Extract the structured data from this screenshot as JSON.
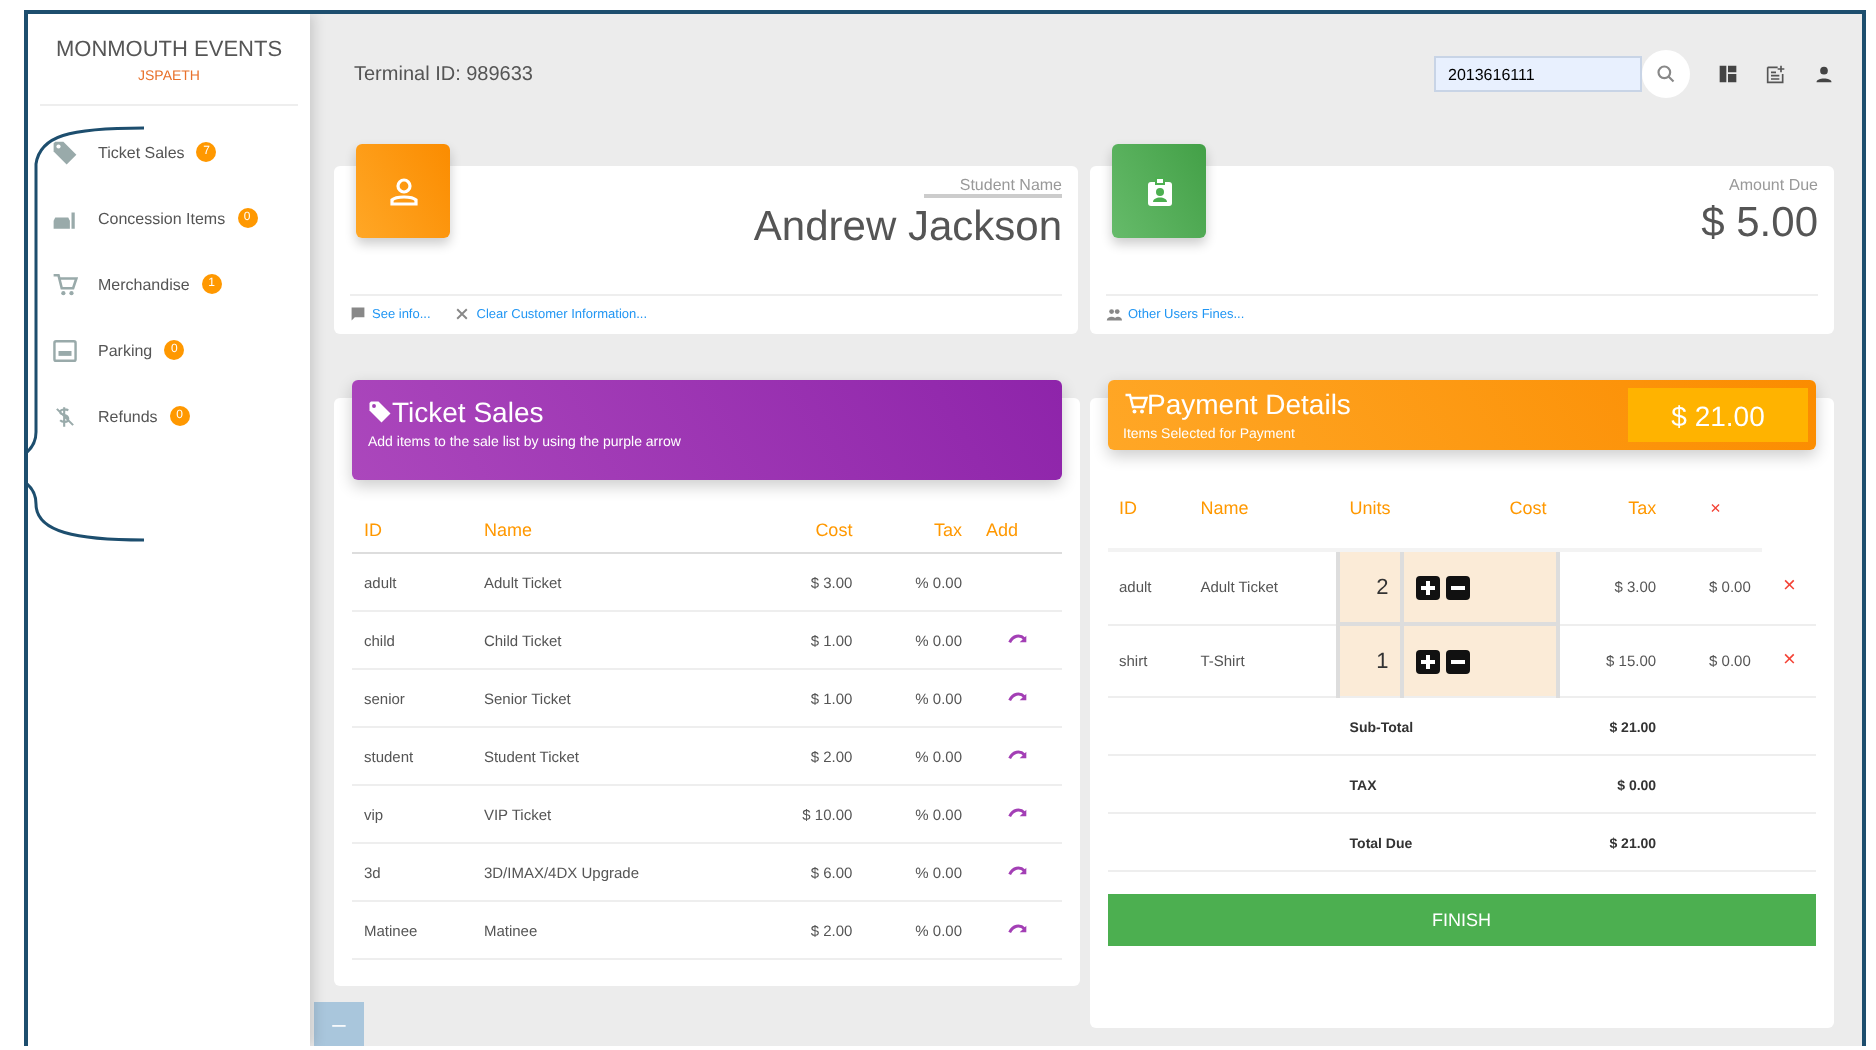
{
  "sidebar": {
    "title": "MONMOUTH EVENTS",
    "user": "JSPAETH",
    "items": [
      {
        "kind": "tag",
        "label": "Ticket Sales",
        "count": "7"
      },
      {
        "kind": "food",
        "label": "Concession Items",
        "count": "0"
      },
      {
        "kind": "cart",
        "label": "Merchandise",
        "count": "1"
      },
      {
        "kind": "parking",
        "label": "Parking",
        "count": "0"
      },
      {
        "kind": "refund",
        "label": "Refunds",
        "count": "0"
      }
    ]
  },
  "topbar": {
    "terminal": "Terminal ID: 989633",
    "search_value": "2013616111"
  },
  "student_card": {
    "label": "Student Name",
    "name": "Andrew Jackson",
    "links": [
      {
        "kind": "info",
        "label": "See info..."
      },
      {
        "kind": "clear",
        "label": "Clear Customer Information..."
      }
    ]
  },
  "amount_card": {
    "label": "Amount Due",
    "amount": "$ 5.00",
    "links": [
      {
        "kind": "users",
        "label": "Other Users Fines..."
      }
    ]
  },
  "ticket_sales": {
    "title": "Ticket Sales",
    "subtitle": "Add items to the sale list by using the purple arrow",
    "columns": [
      "ID",
      "Name",
      "Cost",
      "Tax",
      "Add"
    ],
    "rows": [
      {
        "id": "adult",
        "name": "Adult Ticket",
        "cost": "$ 3.00",
        "tax": "% 0.00",
        "addable": false
      },
      {
        "id": "child",
        "name": "Child Ticket",
        "cost": "$ 1.00",
        "tax": "% 0.00",
        "addable": true
      },
      {
        "id": "senior",
        "name": "Senior Ticket",
        "cost": "$ 1.00",
        "tax": "% 0.00",
        "addable": true
      },
      {
        "id": "student",
        "name": "Student Ticket",
        "cost": "$ 2.00",
        "tax": "% 0.00",
        "addable": true
      },
      {
        "id": "vip",
        "name": "VIP Ticket",
        "cost": "$ 10.00",
        "tax": "% 0.00",
        "addable": true
      },
      {
        "id": "3d",
        "name": "3D/IMAX/4DX Upgrade",
        "cost": "$ 6.00",
        "tax": "% 0.00",
        "addable": true
      },
      {
        "id": "Matinee",
        "name": "Matinee",
        "cost": "$ 2.00",
        "tax": "% 0.00",
        "addable": true
      }
    ]
  },
  "payment": {
    "title": "Payment Details",
    "subtitle": "Items Selected for Payment",
    "total": "$ 21.00",
    "columns": [
      "ID",
      "Name",
      "Units",
      "Cost",
      "Tax",
      "×"
    ],
    "rows": [
      {
        "id": "adult",
        "name": "Adult Ticket",
        "units": "2",
        "cost": "$ 3.00",
        "tax": "$ 0.00",
        "remove": "×"
      },
      {
        "id": "shirt",
        "name": "T-Shirt",
        "units": "1",
        "cost": "$ 15.00",
        "tax": "$ 0.00",
        "remove": "×"
      }
    ],
    "summary": [
      {
        "label": "Sub-Total",
        "value": "$ 21.00"
      },
      {
        "label": "TAX",
        "value": "$ 0.00"
      },
      {
        "label": "Total Due",
        "value": "$ 21.00"
      }
    ],
    "finish": "FINISH"
  },
  "collapse_button": "–"
}
